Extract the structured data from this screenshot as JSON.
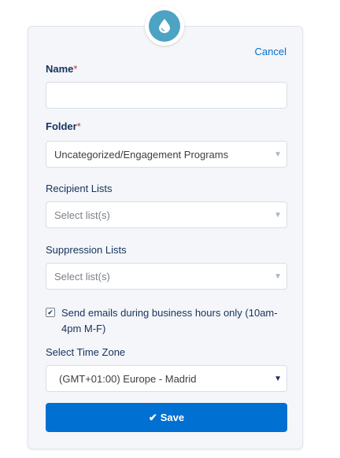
{
  "form": {
    "cancel_label": "Cancel",
    "name": {
      "label": "Name",
      "required_mark": "*",
      "value": ""
    },
    "folder": {
      "label": "Folder",
      "required_mark": "*",
      "value": "Uncategorized/Engagement Programs"
    },
    "recipient_lists": {
      "label": "Recipient Lists",
      "placeholder": "Select list(s)"
    },
    "suppression_lists": {
      "label": "Suppression Lists",
      "placeholder": "Select list(s)"
    },
    "business_hours": {
      "checked": true,
      "label": "Send emails during business hours only (10am-4pm M-F)"
    },
    "time_zone": {
      "label": "Select Time Zone",
      "value": "(GMT+01:00) Europe - Madrid"
    },
    "save_label": "Save"
  },
  "icons": {
    "header": "droplet-icon",
    "dropdown": "chevron-down-icon",
    "checkbox": "checkmark-icon",
    "save": "checkmark-icon"
  },
  "colors": {
    "primary": "#0070d2",
    "badge": "#4ca3c3",
    "required": "#c23934",
    "panel": "#f4f6f9"
  }
}
